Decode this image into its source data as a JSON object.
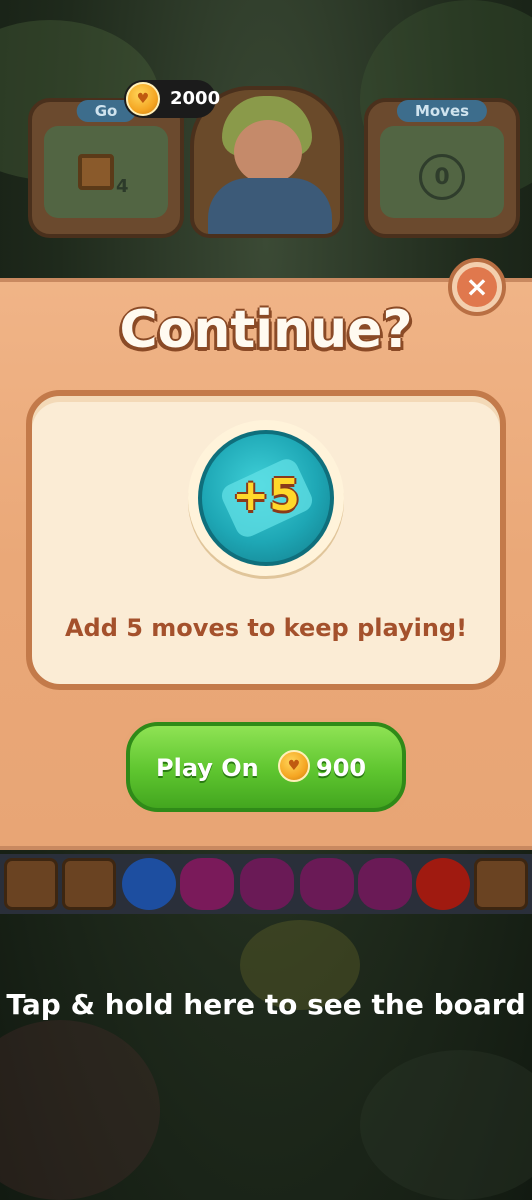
{
  "hud": {
    "goal_tag": "Go",
    "goal_count": "4",
    "moves_tag": "Moves",
    "moves_value": "0",
    "coins": "2000"
  },
  "dialog": {
    "title": "Continue?",
    "badge_text": "+5",
    "description": "Add 5 moves to keep playing!",
    "play_label": "Play On",
    "play_price": "900",
    "close_symbol": "×"
  },
  "hint": "Tap & hold here to see the board",
  "colors": {
    "modal_bg": "#eaa878",
    "card_bg": "#fbecd5",
    "play_button": "#5ec52f",
    "badge": "#1ea7b5",
    "title_outline": "#8a4a26",
    "description": "#a4512c"
  },
  "icons": [
    "coin-icon",
    "close-icon",
    "moves-plus-icon"
  ]
}
